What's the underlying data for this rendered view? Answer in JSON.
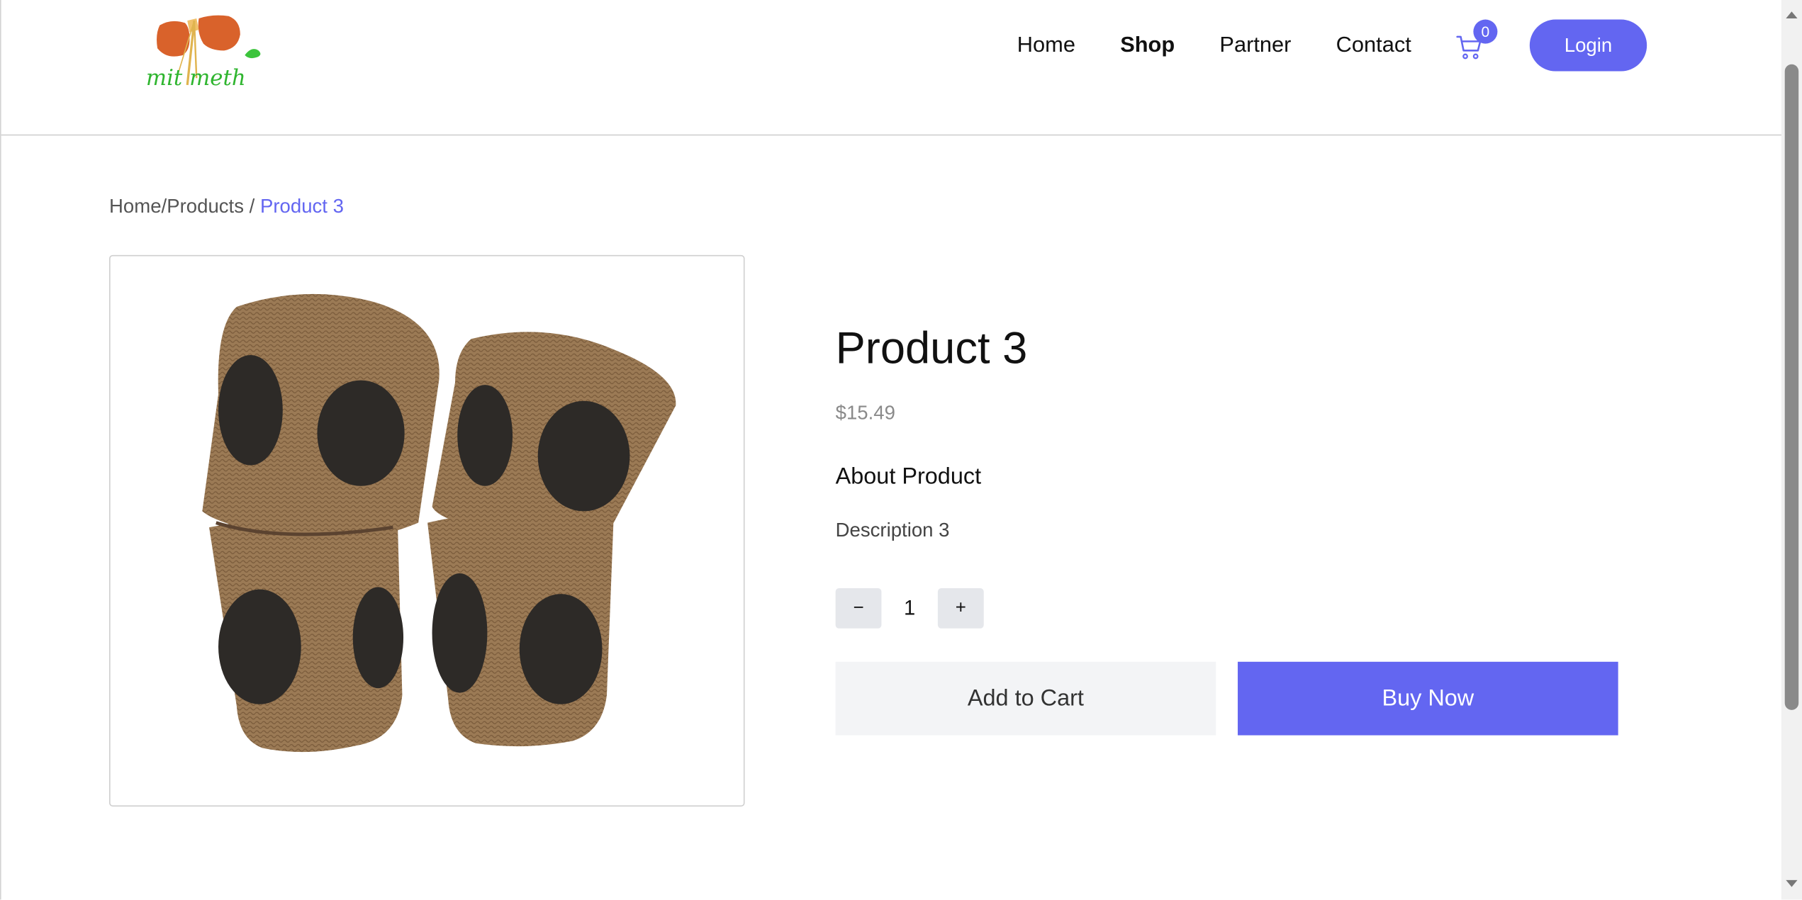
{
  "header": {
    "logo_text": "mit meth",
    "nav": [
      {
        "label": "Home",
        "active": false
      },
      {
        "label": "Shop",
        "active": true
      },
      {
        "label": "Partner",
        "active": false
      },
      {
        "label": "Contact",
        "active": false
      }
    ],
    "cart_count": "0",
    "cart_icon": "cart-icon",
    "login_label": "Login"
  },
  "breadcrumb": {
    "home": "Home",
    "sep1": "/",
    "products": "Products",
    "sep2": " / ",
    "current": "Product 3"
  },
  "product": {
    "title": "Product 3",
    "price": "$15.49",
    "about_heading": "About Product",
    "description": "Description 3",
    "image_alt": "woven baskets with black dots",
    "quantity": "1",
    "decrement_label": "−",
    "increment_label": "+",
    "add_to_cart_label": "Add to Cart",
    "buy_now_label": "Buy Now"
  },
  "colors": {
    "accent": "#6366f1",
    "button_gray": "#f3f4f6"
  }
}
